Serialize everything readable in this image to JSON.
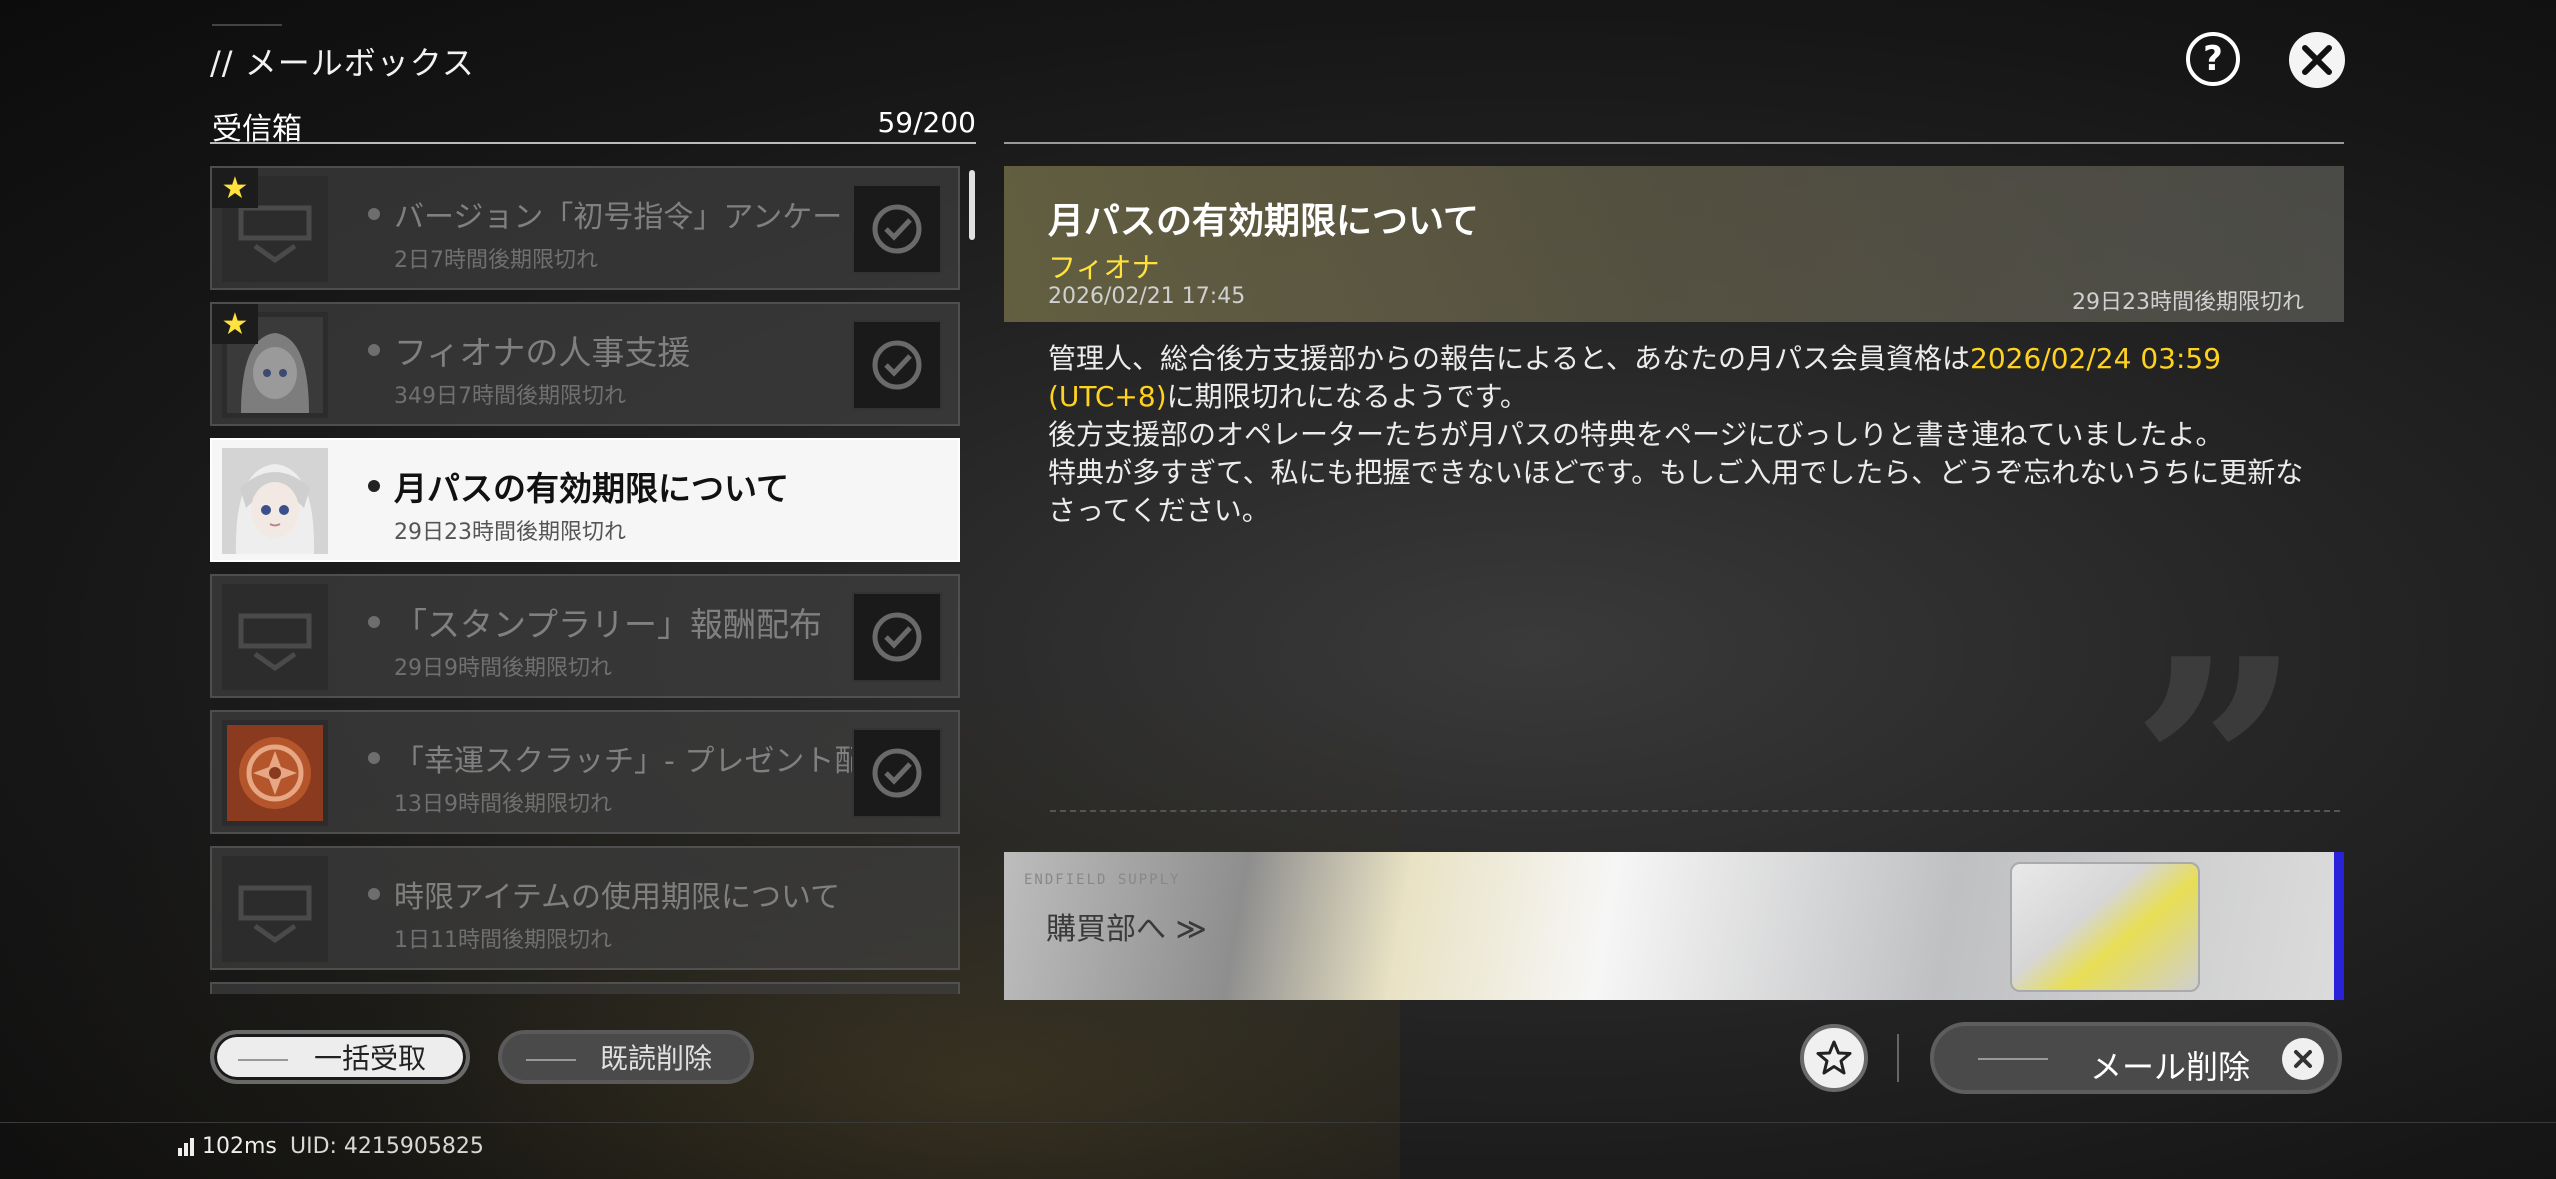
{
  "header": {
    "title": "// メールボックス"
  },
  "inbox": {
    "label": "受信箱",
    "count": "59/200"
  },
  "mails": [
    {
      "title": "バージョン「初号指令」アンケート",
      "expire": "2日7時間後期限切れ",
      "starred": true,
      "thumb_icon": "game-logo-icon",
      "claimed": true
    },
    {
      "title": "フィオナの人事支援",
      "expire": "349日7時間後期限切れ",
      "starred": true,
      "thumb_icon": "fiona-avatar",
      "claimed": true
    },
    {
      "title": "月パスの有効期限について",
      "expire": "29日23時間後期限切れ",
      "starred": false,
      "thumb_icon": "fiona-avatar",
      "selected": true
    },
    {
      "title": "「スタンプラリー」報酬配布",
      "expire": "29日9時間後期限切れ",
      "starred": false,
      "thumb_icon": "game-logo-icon",
      "claimed": true
    },
    {
      "title": "「幸運スクラッチ」- プレゼント配布",
      "expire": "13日9時間後期限切れ",
      "starred": false,
      "thumb_icon": "orange-emblem-icon",
      "claimed": true
    },
    {
      "title": "時限アイテムの使用期限について",
      "expire": "1日11時間後期限切れ",
      "starred": false,
      "thumb_icon": "game-logo-icon"
    }
  ],
  "detail": {
    "title": "月パスの有効期限について",
    "sender": "フィオナ",
    "date": "2026/02/21 17:45",
    "expire": "29日23時間後期限切れ",
    "body_1a": "管理人、総合後方支援部からの報告によると、あなたの月パス会員資格は",
    "body_1_highlight": "2026/02/24 03:59 (UTC+8)",
    "body_1b": "に期限切れになるようです。",
    "body_2": "後方支援部のオペレーターたちが月パスの特典をページにびっしりと書き連ねていましたよ。",
    "body_3": "特典が多すぎて、私にも把握できないほどです。もしご入用でしたら、どうぞ忘れないうちに更新なさってください。"
  },
  "banner": {
    "small_text": "ENDFIELD SUPPLY",
    "label": "購買部へ ≫"
  },
  "actions": {
    "claim_all": "一括受取",
    "delete_read": "既読削除",
    "delete_mail": "メール削除"
  },
  "footer": {
    "ping": "102ms",
    "uid": "UID: 4215905825"
  },
  "colors": {
    "accent_yellow": "#ffd21f",
    "selected_bg": "#f6f6f6",
    "banner_edge": "#2a22d8"
  }
}
